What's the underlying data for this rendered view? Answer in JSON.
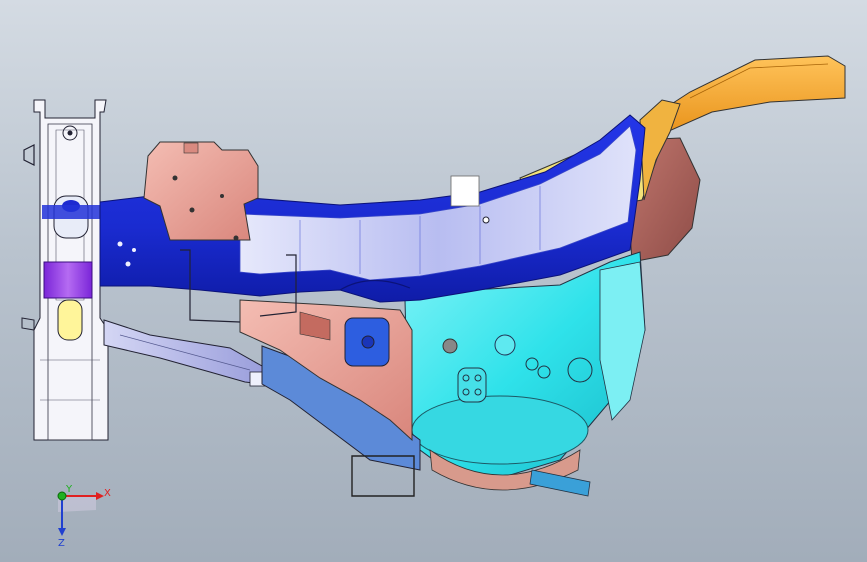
{
  "triad": {
    "x_label": "X",
    "y_label": "Y",
    "z_label": "Z",
    "x_color": "#e02020",
    "y_color": "#20b020",
    "z_color": "#2040d0"
  },
  "colors": {
    "background_top": "#d4dbe3",
    "background_bottom": "#a2adba",
    "rail_blue": "#1a2fd6",
    "rail_highlight": "#c8ccf4",
    "orange_bracket": "#f5a623",
    "yellow_panel": "#f2e27a",
    "brown_panel": "#a9605a",
    "salmon_part": "#e6a59c",
    "cyan_tower": "#2ee0e8",
    "lavender_arm": "#b8bbe8",
    "white_frame": "#f4f4f8"
  }
}
